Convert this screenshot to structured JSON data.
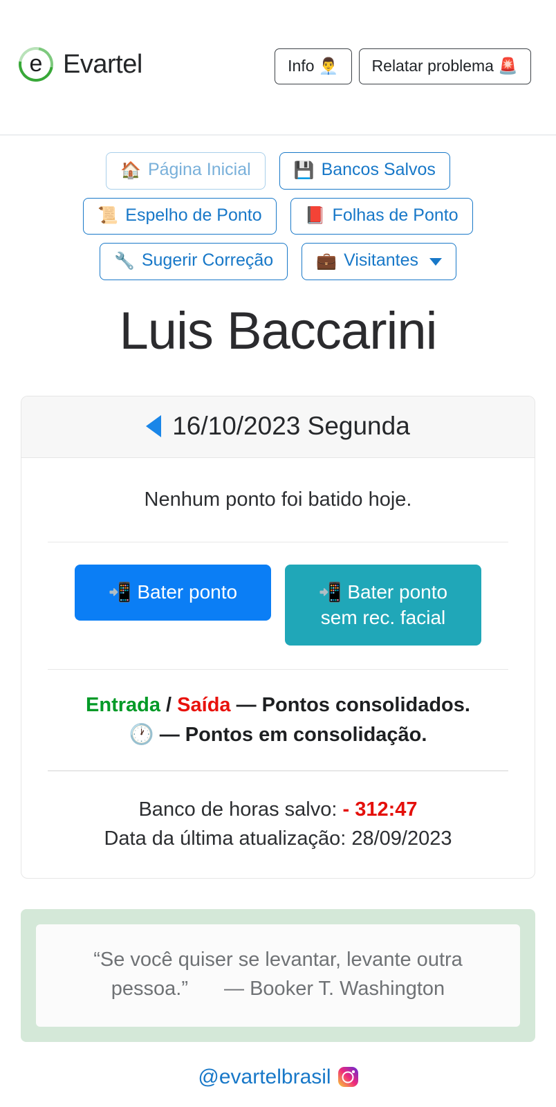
{
  "header": {
    "brand_name": "Evartel",
    "brand_logo_glyph": "e",
    "actions": [
      {
        "label": "Info",
        "icon": "👨‍💼",
        "icon_name": "office-worker-icon"
      },
      {
        "label": "Relatar problema",
        "icon": "🚨",
        "icon_name": "siren-icon"
      }
    ]
  },
  "nav": {
    "rows": [
      [
        {
          "label": "Página Inicial",
          "icon": "🏠",
          "icon_name": "home-icon",
          "disabled": true
        },
        {
          "label": "Bancos Salvos",
          "icon": "💾",
          "icon_name": "floppy-disk-icon",
          "disabled": false
        }
      ],
      [
        {
          "label": "Espelho de Ponto",
          "icon": "📜",
          "icon_name": "scroll-icon",
          "disabled": false
        },
        {
          "label": "Folhas de Ponto",
          "icon": "📕",
          "icon_name": "pdf-file-icon",
          "disabled": false
        }
      ],
      [
        {
          "label": "Sugerir Correção",
          "icon": "🔧",
          "icon_name": "wrench-icon",
          "disabled": false
        },
        {
          "label": "Visitantes",
          "icon": "💼",
          "icon_name": "briefcase-icon",
          "disabled": false,
          "dropdown": true
        }
      ]
    ]
  },
  "page": {
    "title": "Luis Baccarini"
  },
  "card": {
    "date": "16/10/2023",
    "weekday": "Segunda",
    "header_title": "16/10/2023 Segunda",
    "prev_day_icon": "left-triangle",
    "status_message": "Nenhum ponto foi batido hoje.",
    "punch_buttons": [
      {
        "label": "Bater ponto",
        "icon": "📲",
        "icon_name": "mobile-phone-arrow-icon",
        "color": "#0b7ef5"
      },
      {
        "label": "Bater ponto sem rec. facial",
        "icon": "📲",
        "icon_name": "mobile-phone-arrow-icon",
        "color": "#20a7b8"
      }
    ],
    "legend": {
      "entrada": "Entrada",
      "separator": " / ",
      "saida": "Saída",
      "consolidated_text": " — Pontos consolidados.",
      "clock_icon": "🕐",
      "consolidating_text": " — Pontos em consolidação.",
      "entrada_color": "#009a27",
      "saida_color": "#e8120c"
    },
    "bank": {
      "label": "Banco de horas salvo:",
      "value": "- 312:47",
      "value_color": "#e4100b",
      "updated_label": "Data da última atualização:",
      "updated_value": "28/09/2023"
    }
  },
  "quote": {
    "text": "“Se você quiser se levantar, levante outra pessoa.”",
    "author": "— Booker T. Washington",
    "box_color": "#d4e8d8"
  },
  "footer": {
    "handle": "@evartelbrasil",
    "icon_name": "instagram-icon"
  }
}
